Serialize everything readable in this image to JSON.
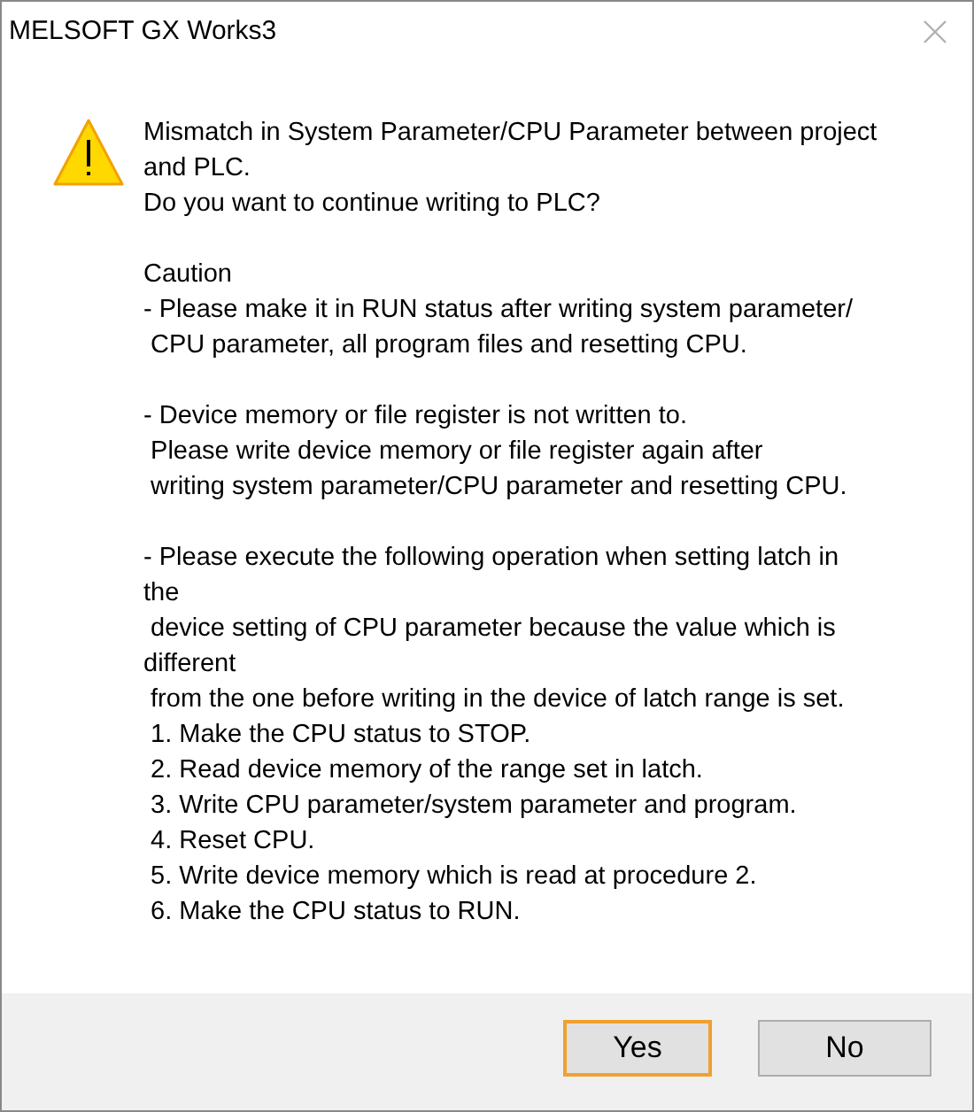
{
  "window": {
    "title": "MELSOFT GX Works3"
  },
  "message": {
    "paragraphs": [
      [
        "Mismatch in System Parameter/CPU Parameter between project",
        "and PLC.",
        "Do you want to continue writing to PLC?"
      ],
      [
        "Caution",
        "- Please make it in RUN status after writing system parameter/",
        " CPU parameter, all program files and resetting CPU."
      ],
      [
        "- Device memory or file register is not written to.",
        " Please write device memory or file register again after",
        " writing system parameter/CPU parameter and resetting CPU."
      ],
      [
        "- Please execute the following operation when setting latch in",
        "the",
        " device setting of CPU parameter because the value which is",
        "different",
        " from the one before writing in the device of latch range is set.",
        " 1. Make the CPU status to STOP.",
        " 2. Read device memory of the range set in latch.",
        " 3. Write CPU parameter/system parameter and program.",
        " 4. Reset CPU.",
        " 5. Write device memory which is read at procedure 2.",
        " 6. Make the CPU status to RUN."
      ]
    ]
  },
  "buttons": [
    {
      "label": "Yes",
      "selected": true
    },
    {
      "label": "No",
      "selected": false
    }
  ]
}
